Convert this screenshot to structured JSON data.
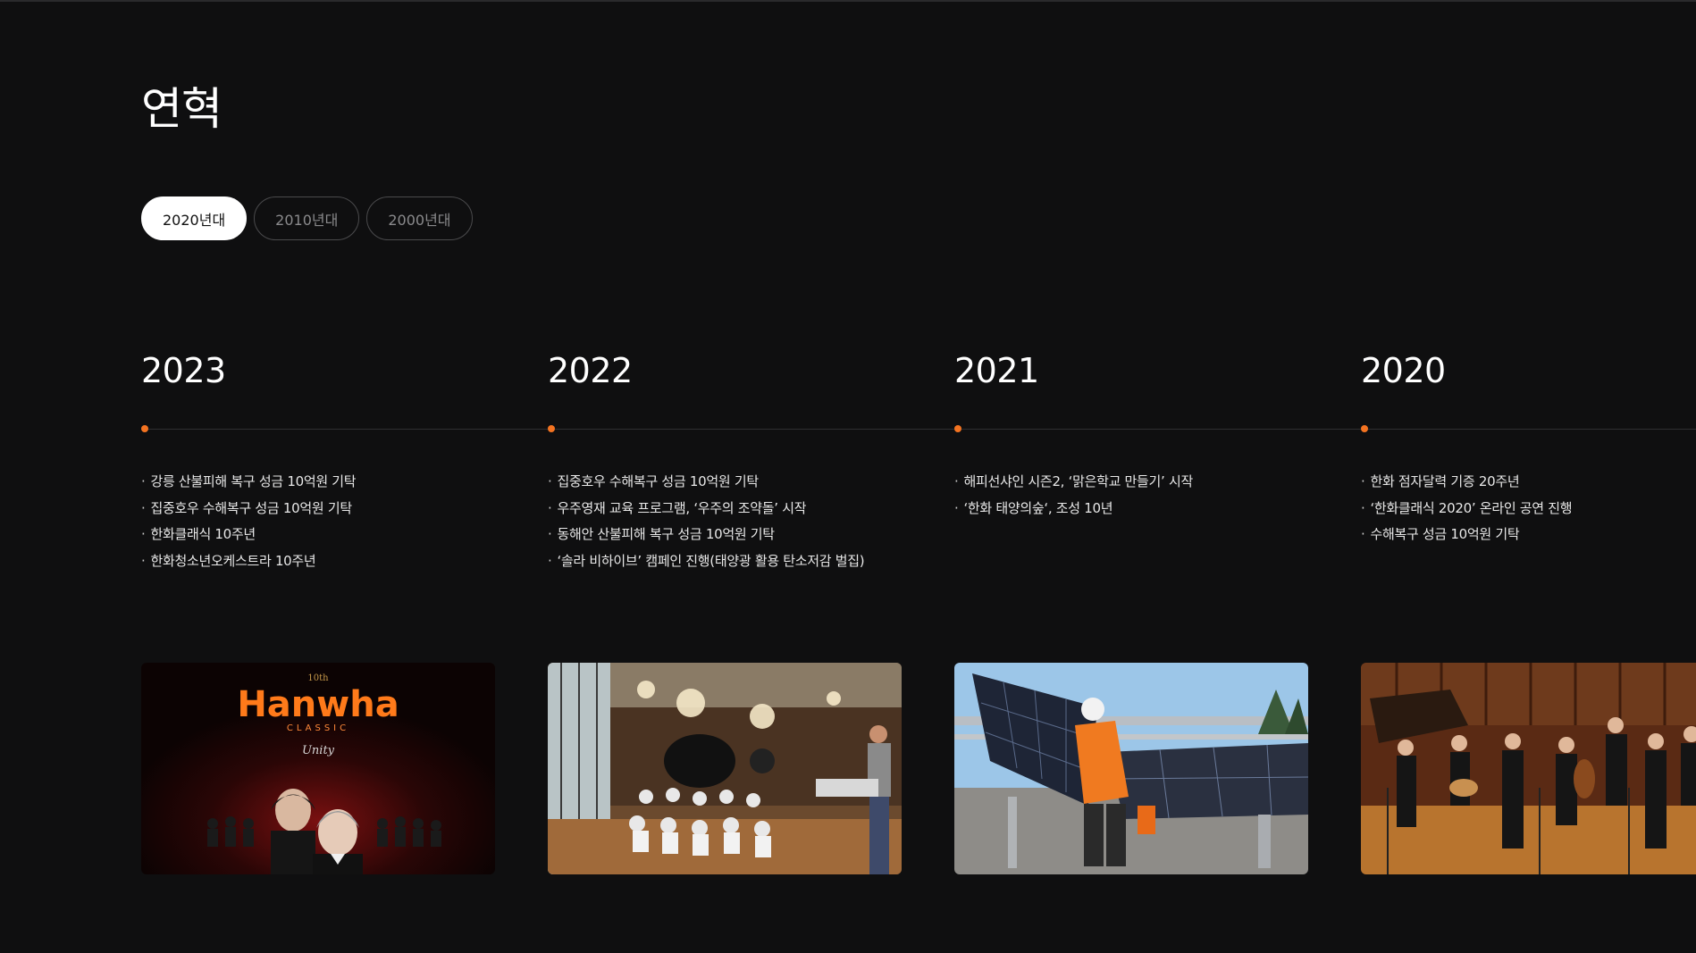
{
  "page": {
    "title": "연혁"
  },
  "tabs": [
    {
      "label": "2020년대",
      "active": true
    },
    {
      "label": "2010년대",
      "active": false
    },
    {
      "label": "2000년대",
      "active": false
    }
  ],
  "colors": {
    "background": "#0f0f10",
    "accent": "#f37321",
    "active_tab_bg": "#ffffff"
  },
  "timeline": [
    {
      "year": "2023",
      "events": [
        "강릉 산불피해 복구 성금 10억원 기탁",
        "집중호우 수해복구 성금 10억원 기탁",
        "한화클래식 10주년",
        "한화청소년오케스트라 10주년"
      ],
      "image": {
        "description_icon": "hanwha-classic-poster",
        "logo_text": "Hanwha",
        "sub_text": "CLASSIC",
        "script_text": "Unity",
        "badge_text": "10th"
      }
    },
    {
      "year": "2022",
      "events": [
        "집중호우 수해복구 성금 10억원 기탁",
        "우주영재 교육 프로그램, ‘우주의 조약돌’ 시작",
        "동해안 산불피해 복구 성금 10억원 기탁",
        "‘솔라 비하이브’ 캠페인 진행(태양광 활용 탄소저감 벌집)"
      ],
      "image": {
        "description_icon": "classroom-photo"
      }
    },
    {
      "year": "2021",
      "events": [
        "해피선샤인 시즌2, ‘맑은학교 만들기’ 시작",
        "‘한화 태양의숲‘, 조성 10년"
      ],
      "image": {
        "description_icon": "solar-panel-photo"
      }
    },
    {
      "year": "2020",
      "events": [
        "한화 점자달력 기증 20주년",
        "‘한화클래식 2020’ 온라인 공연 진행",
        "수해복구 성금 10억원 기탁"
      ],
      "image": {
        "description_icon": "orchestra-photo"
      }
    }
  ]
}
